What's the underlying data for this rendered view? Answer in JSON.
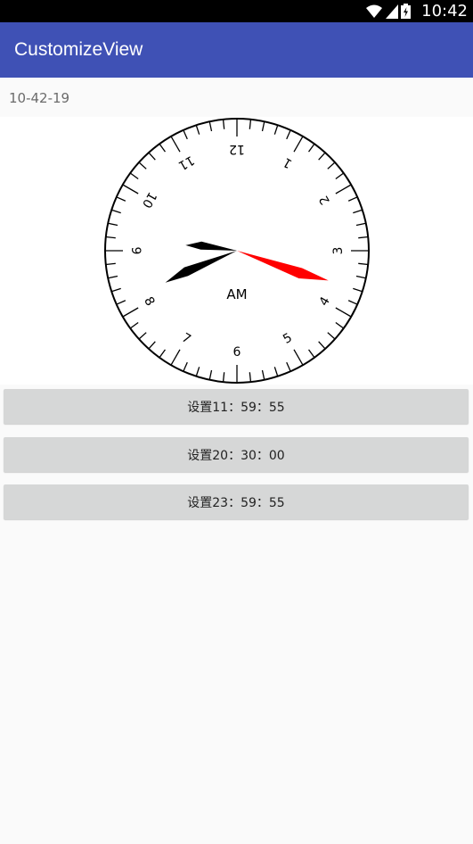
{
  "status_bar": {
    "time": "10:42",
    "icons": [
      "wifi-icon",
      "signal-icon",
      "battery-icon"
    ]
  },
  "app_bar": {
    "title": "CustomizeView",
    "color": "#3f51b5"
  },
  "time_text": "10-42-19",
  "clock": {
    "numbers": [
      "12",
      "1",
      "2",
      "3",
      "4",
      "5",
      "6",
      "7",
      "8",
      "9",
      "10",
      "11"
    ],
    "period": "AM",
    "hour": 8.2,
    "minute": 46,
    "second": 19,
    "second_hand_color": "#ff0000",
    "hand_color": "#000000"
  },
  "buttons": [
    {
      "label": "设置11：59：55"
    },
    {
      "label": "设置20：30：00"
    },
    {
      "label": "设置23：59：55"
    }
  ]
}
